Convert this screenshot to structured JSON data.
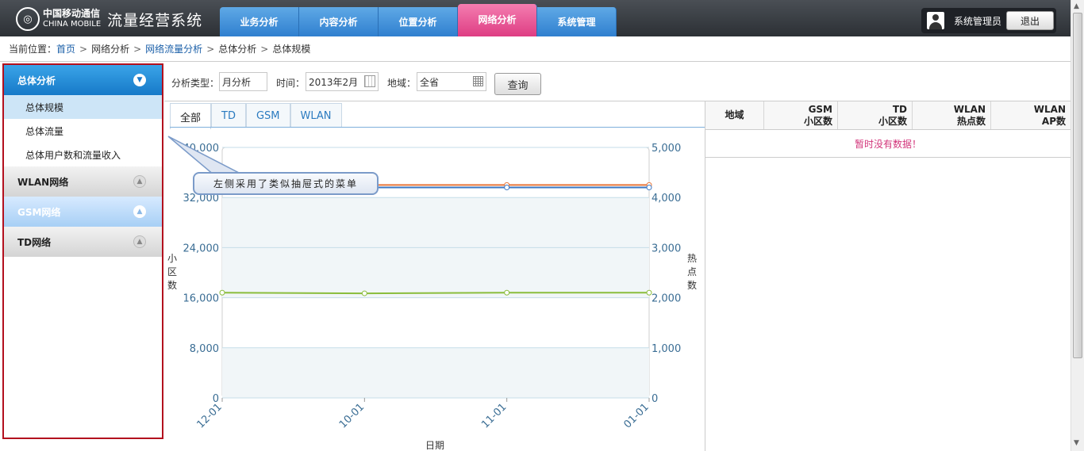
{
  "header": {
    "logo_cn": "中国移动通信",
    "logo_en": "CHINA MOBILE",
    "system_title": "流量经营系统",
    "nav_tabs": [
      "业务分析",
      "内容分析",
      "位置分析",
      "网络分析",
      "系统管理"
    ],
    "active_tab": "网络分析",
    "username": "系统管理员",
    "logout_label": "退出"
  },
  "breadcrumb": {
    "prefix": "当前位置：",
    "items": [
      "首页",
      "网络分析",
      "网络流量分析",
      "总体分析",
      "总体规模"
    ],
    "separator": ">"
  },
  "sidebar": {
    "groups": [
      {
        "label": "总体分析",
        "state": "open",
        "items": [
          "总体规模",
          "总体流量",
          "总体用户数和流量收入"
        ],
        "active_item": "总体规模"
      },
      {
        "label": "WLAN网络",
        "state": "closed"
      },
      {
        "label": "GSM网络",
        "state": "closed"
      },
      {
        "label": "TD网络",
        "state": "closed"
      }
    ]
  },
  "filters": {
    "type_label": "分析类型：",
    "type_value": "月分析",
    "time_label": "时间：",
    "time_value": "2013年2月",
    "region_label": "地域：",
    "region_value": "全省",
    "query_label": "查询"
  },
  "chart_tabs": [
    "全部",
    "TD",
    "GSM",
    "WLAN"
  ],
  "active_chart_tab": "全部",
  "callout_text": "左侧采用了类似抽屉式的菜单",
  "colors": {
    "series_orange": "#e8763a",
    "series_blue": "#3b78c4",
    "series_green": "#8bbd3c",
    "accent_pink": "#de3d83",
    "nav_blue": "#2f7fcf"
  },
  "chart_data": {
    "type": "line",
    "categories": [
      "12-01",
      "10-01",
      "11-01",
      "01-01"
    ],
    "xlabel": "日期",
    "ylabel_left": "小区数",
    "ylabel_right": "热点数",
    "ylim_left": [
      0,
      40000
    ],
    "ylim_right": [
      0,
      5000
    ],
    "yticks_left": [
      "0",
      "8,000",
      "16,000",
      "24,000",
      "32,000",
      "40,000"
    ],
    "yticks_right": [
      "0",
      "1,000",
      "2,000",
      "3,000",
      "4,000",
      "5,000"
    ],
    "series": [
      {
        "axis": "left",
        "color": "#e8763a",
        "values": [
          34000,
          34000,
          34000,
          34000
        ]
      },
      {
        "axis": "left",
        "color": "#3b78c4",
        "values": [
          33500,
          33600,
          33600,
          33600
        ]
      },
      {
        "axis": "left",
        "color": "#8bbd3c",
        "values": [
          16800,
          16700,
          16800,
          16800
        ]
      }
    ],
    "grid": true
  },
  "table": {
    "headers": [
      [
        "地域"
      ],
      [
        "GSM",
        "小区数"
      ],
      [
        "TD",
        "小区数"
      ],
      [
        "WLAN",
        "热点数"
      ],
      [
        "WLAN",
        "AP数"
      ]
    ],
    "empty_text": "暂时没有数据！"
  }
}
